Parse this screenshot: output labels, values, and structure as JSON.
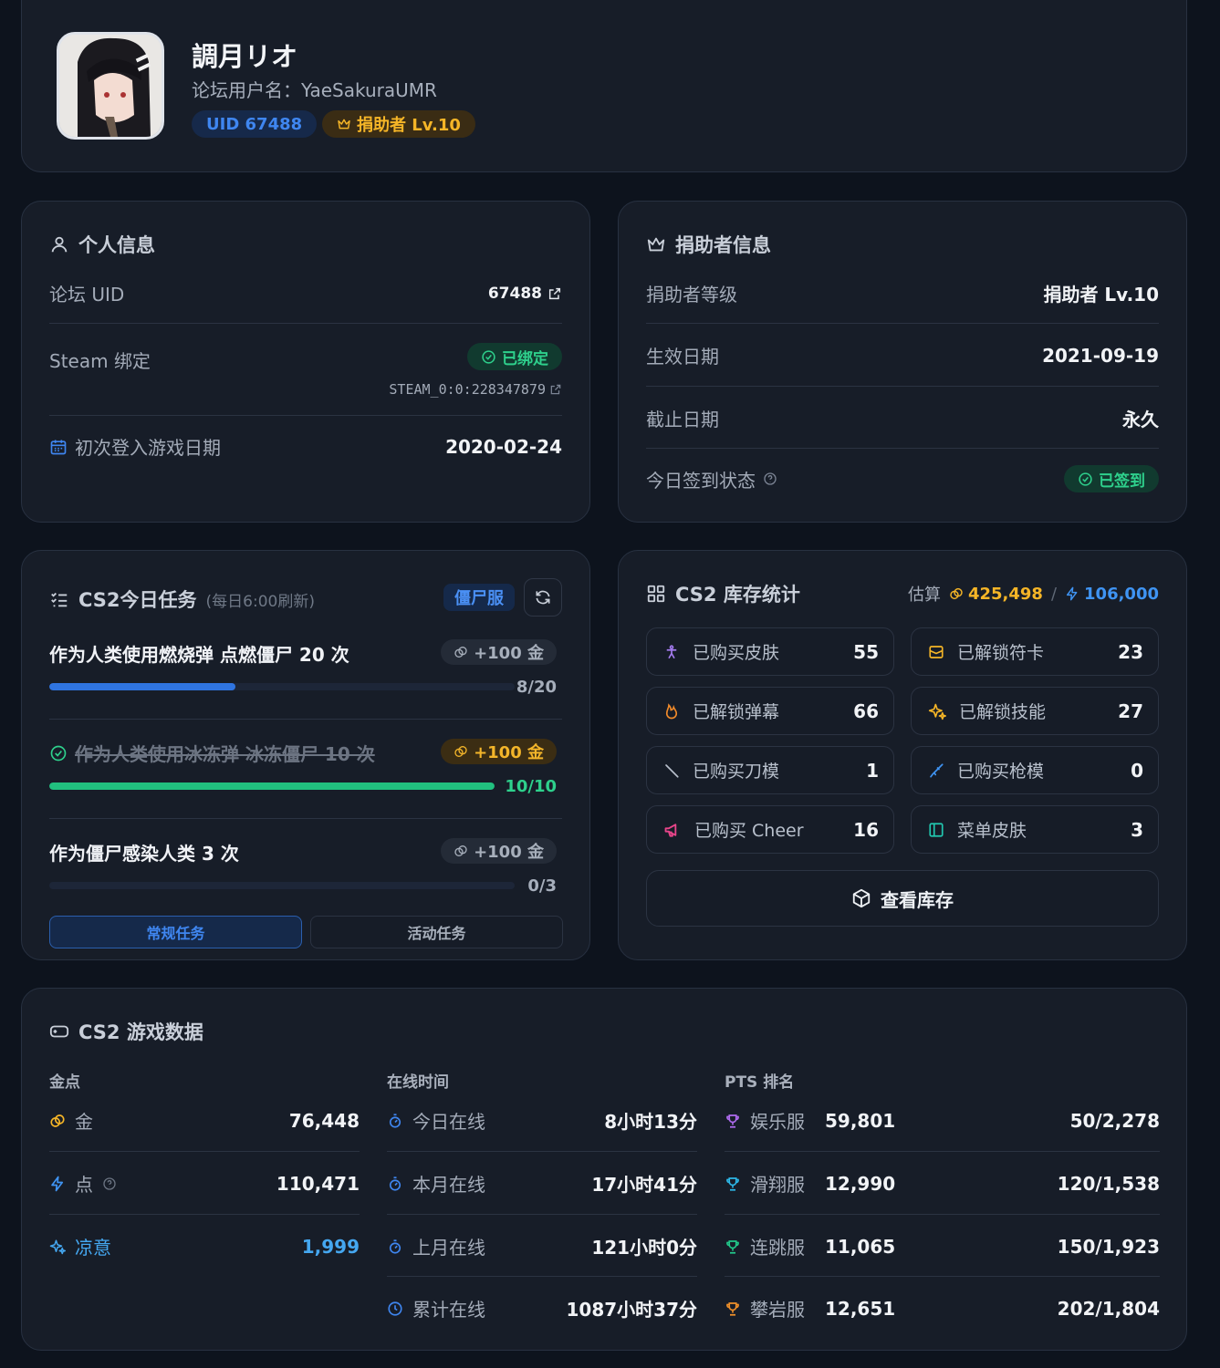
{
  "profile": {
    "name": "調月リオ",
    "username": "论坛用户名：YaeSakuraUMR",
    "uid_badge": "UID 67488",
    "donor_badge": "捐助者 Lv.10"
  },
  "personal": {
    "title": "个人信息",
    "uid_label": "论坛 UID",
    "uid_value": "67488",
    "steam_label": "Steam 绑定",
    "steam_status": "已绑定",
    "steam_id": "STEAM_0:0:228347879",
    "first_login_label": "初次登入游戏日期",
    "first_login_value": "2020-02-24"
  },
  "donor": {
    "title": "捐助者信息",
    "level_label": "捐助者等级",
    "level_value": "捐助者 Lv.10",
    "start_label": "生效日期",
    "start_value": "2021-09-19",
    "end_label": "截止日期",
    "end_value": "永久",
    "checkin_label": "今日签到状态",
    "checkin_value": "已签到"
  },
  "tasks": {
    "title": "CS2今日任务",
    "subtitle": "(每日6:00刷新)",
    "server_badge": "僵尸服",
    "items": [
      {
        "title": "作为人类使用燃烧弹 点燃僵尸 20 次",
        "reward": "+100 金",
        "progress_text": "8/20",
        "progress": 0.4
      },
      {
        "title": "作为人类使用冰冻弹 冰冻僵尸 10 次",
        "reward": "+100 金",
        "progress_text": "10/10",
        "progress": 1.0
      },
      {
        "title": "作为僵尸感染人类 3 次",
        "reward": "+100 金",
        "progress_text": "0/3",
        "progress": 0
      }
    ],
    "tab_regular": "常规任务",
    "tab_event": "活动任务"
  },
  "inventory": {
    "title": "CS2 库存统计",
    "estimate_label": "估算",
    "gold_value": "425,498",
    "slash": "/",
    "points_value": "106,000",
    "stats": [
      {
        "label": "已购买皮肤",
        "value": "55",
        "icon": "person-icon"
      },
      {
        "label": "已解锁符卡",
        "value": "23",
        "icon": "card-icon"
      },
      {
        "label": "已解锁弹幕",
        "value": "66",
        "icon": "flame-icon"
      },
      {
        "label": "已解锁技能",
        "value": "27",
        "icon": "sparkle-icon"
      },
      {
        "label": "已购买刀模",
        "value": "1",
        "icon": "knife-icon"
      },
      {
        "label": "已购买枪模",
        "value": "0",
        "icon": "rifle-icon"
      },
      {
        "label": "已购买 Cheer",
        "value": "16",
        "icon": "megaphone-icon"
      },
      {
        "label": "菜单皮肤",
        "value": "3",
        "icon": "panel-icon"
      }
    ],
    "view_button": "查看库存"
  },
  "game": {
    "title": "CS2 游戏数据",
    "col_currency": "金点",
    "col_online": "在线时间",
    "col_pts": "PTS 排名",
    "currency": [
      {
        "label": "金",
        "value": "76,448"
      },
      {
        "label": "点",
        "value": "110,471"
      },
      {
        "label": "凉意",
        "value": "1,999"
      }
    ],
    "online": [
      {
        "label": "今日在线",
        "value": "8小时13分"
      },
      {
        "label": "本月在线",
        "value": "17小时41分"
      },
      {
        "label": "上月在线",
        "value": "121小时0分"
      },
      {
        "label": "累计在线",
        "value": "1087小时37分"
      }
    ],
    "pts": [
      {
        "label": "娱乐服",
        "score": "59,801",
        "rank": "50/2,278",
        "color": "#b06cf0"
      },
      {
        "label": "滑翔服",
        "score": "12,990",
        "rank": "120/1,538",
        "color": "#2db8e8"
      },
      {
        "label": "连跳服",
        "score": "11,065",
        "rank": "150/1,923",
        "color": "#22c88a"
      },
      {
        "label": "攀岩服",
        "score": "12,651",
        "rank": "202/1,804",
        "color": "#f0902a"
      }
    ]
  },
  "colors": {
    "accent_blue": "#3f86f0",
    "gold": "#f5b527",
    "green": "#2ed08c",
    "card_bg": "#171d28",
    "page_bg": "#0d131d"
  }
}
